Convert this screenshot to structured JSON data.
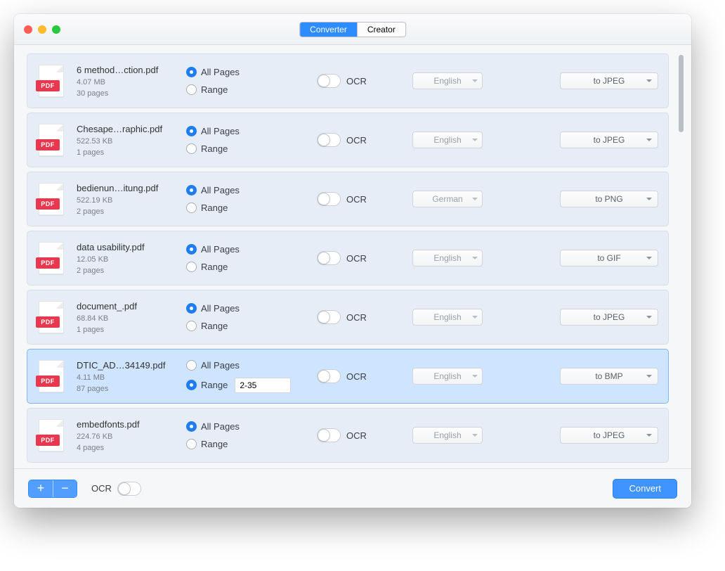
{
  "tabs": {
    "converter": "Converter",
    "creator": "Creator"
  },
  "labels": {
    "all_pages": "All Pages",
    "range": "Range",
    "ocr": "OCR",
    "pdf_badge": "PDF"
  },
  "footer": {
    "ocr_label": "OCR",
    "convert": "Convert",
    "plus": "+",
    "minus": "−"
  },
  "files": [
    {
      "name": "6 method…ction.pdf",
      "size": "4.07 MB",
      "pages": "30 pages",
      "page_mode": "all",
      "range_value": "",
      "ocr_on": false,
      "lang": "English",
      "format": "to JPEG",
      "selected": false
    },
    {
      "name": "Chesape…raphic.pdf",
      "size": "522.53 KB",
      "pages": "1 pages",
      "page_mode": "all",
      "range_value": "",
      "ocr_on": false,
      "lang": "English",
      "format": "to JPEG",
      "selected": false
    },
    {
      "name": "bedienun…itung.pdf",
      "size": "522.19 KB",
      "pages": "2 pages",
      "page_mode": "all",
      "range_value": "",
      "ocr_on": false,
      "lang": "German",
      "format": "to PNG",
      "selected": false
    },
    {
      "name": "data usability.pdf",
      "size": "12.05 KB",
      "pages": "2 pages",
      "page_mode": "all",
      "range_value": "",
      "ocr_on": false,
      "lang": "English",
      "format": "to GIF",
      "selected": false
    },
    {
      "name": "document_.pdf",
      "size": "68.84 KB",
      "pages": "1 pages",
      "page_mode": "all",
      "range_value": "",
      "ocr_on": false,
      "lang": "English",
      "format": "to JPEG",
      "selected": false
    },
    {
      "name": "DTIC_AD…34149.pdf",
      "size": "4.11 MB",
      "pages": "87 pages",
      "page_mode": "range",
      "range_value": "2-35",
      "ocr_on": false,
      "lang": "English",
      "format": "to BMP",
      "selected": true
    },
    {
      "name": "embedfonts.pdf",
      "size": "224.76 KB",
      "pages": "4 pages",
      "page_mode": "all",
      "range_value": "",
      "ocr_on": false,
      "lang": "English",
      "format": "to JPEG",
      "selected": false
    }
  ]
}
